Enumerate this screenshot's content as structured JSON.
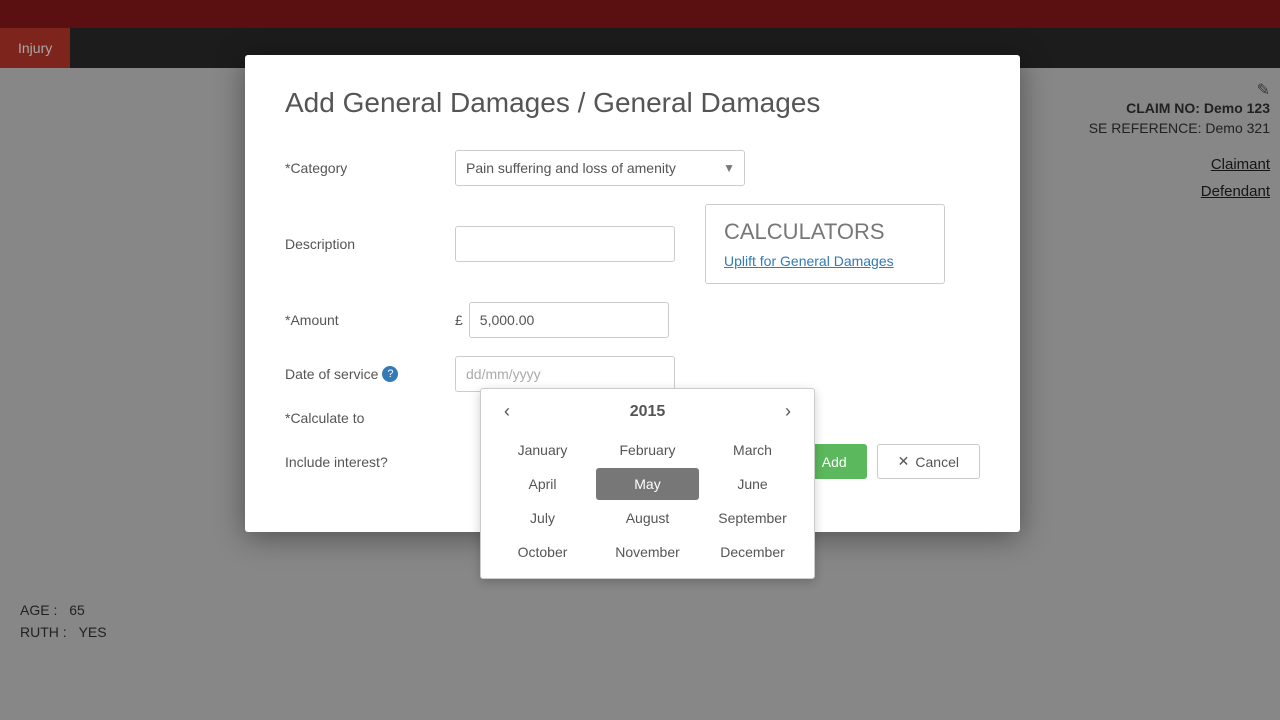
{
  "topBar": {},
  "navBar": {
    "injuryLabel": "Injury"
  },
  "rightInfo": {
    "claimNo": "CLAIM NO: Demo 123",
    "caseRef": "SE REFERENCE: Demo 321",
    "claimantLabel": "Claimant",
    "defendantLabel": "Defendant"
  },
  "bottomInfo": {
    "ageLabel": "AGE :",
    "ageValue": "65",
    "truthLabel": "RUTH :",
    "truthValue": "YES"
  },
  "modal": {
    "title": "Add General Damages / General Damages",
    "categoryLabel": "*Category",
    "categoryValue": "Pain suffering and loss of amenity",
    "descriptionLabel": "Description",
    "descriptionPlaceholder": "",
    "amountLabel": "*Amount",
    "amountValue": "5,000.00",
    "currencySymbol": "£",
    "dateLabel": "Date of service",
    "datePlaceholder": "dd/mm/yyyy",
    "calculateToLabel": "*Calculate to",
    "includeInterestLabel": "Include interest?",
    "calculatorsTitle": "CALCULATORS",
    "calculatorsLink": "Uplift for General Damages",
    "addButtonLabel": "Add",
    "cancelButtonLabel": "Cancel"
  },
  "calendar": {
    "year": "2015",
    "months": [
      "January",
      "February",
      "March",
      "April",
      "May",
      "June",
      "July",
      "August",
      "September",
      "October",
      "November",
      "December"
    ],
    "activeMonth": "May",
    "prevArrow": "‹",
    "nextArrow": "›"
  }
}
